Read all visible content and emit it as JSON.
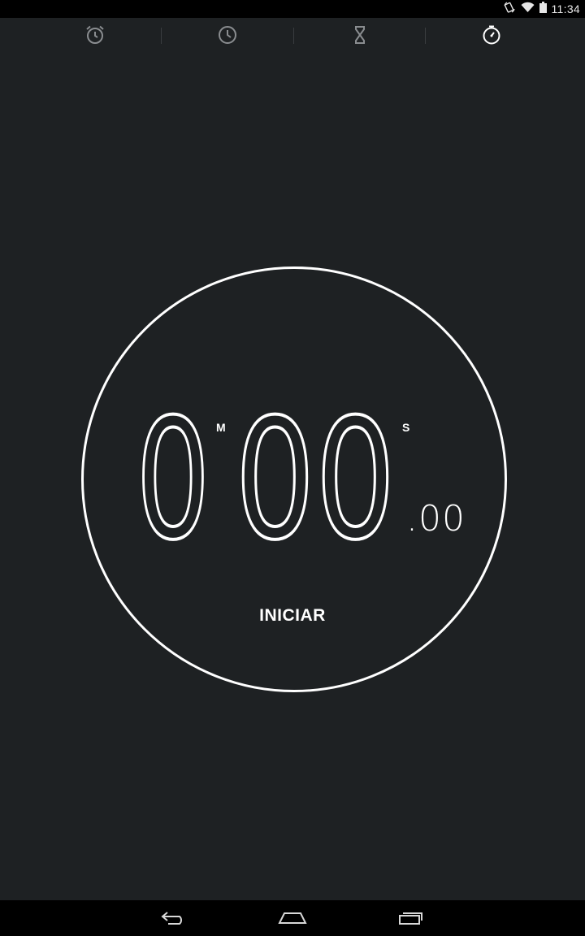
{
  "status_bar": {
    "time": "11:34",
    "icons": [
      "rotation-lock-icon",
      "wifi-icon",
      "battery-icon"
    ]
  },
  "tabs": [
    {
      "id": "alarm",
      "icon": "alarm-clock-icon",
      "active": false
    },
    {
      "id": "clock",
      "icon": "clock-icon",
      "active": false
    },
    {
      "id": "timer",
      "icon": "hourglass-icon",
      "active": false
    },
    {
      "id": "stopwatch",
      "icon": "stopwatch-icon",
      "active": true
    }
  ],
  "stopwatch": {
    "minutes": "0",
    "seconds": "00",
    "hundredths": ".00",
    "minutes_unit": "M",
    "seconds_unit": "S",
    "start_label": "INICIAR"
  },
  "nav_bar": {
    "buttons": [
      "back-icon",
      "home-icon",
      "recent-apps-icon"
    ]
  },
  "colors": {
    "background": "#1e2123",
    "bars": "#000000",
    "foreground": "#ffffff",
    "inactive_icon": "#8a8d90"
  }
}
